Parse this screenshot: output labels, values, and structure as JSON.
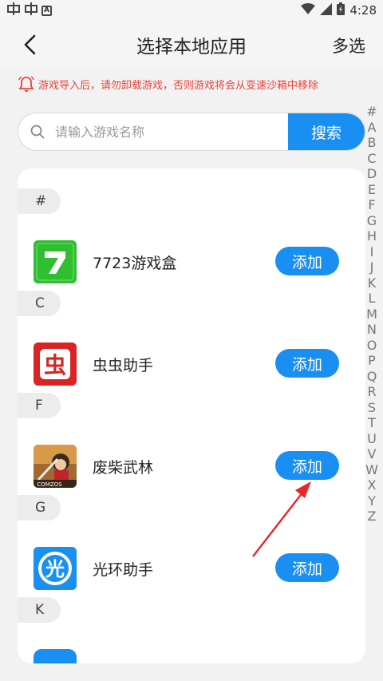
{
  "status_bar": {
    "time": "4:28",
    "left_icon_a": "A"
  },
  "header": {
    "title": "选择本地应用",
    "multi_select_label": "多选"
  },
  "notice": {
    "text": "游戏导入后，请勿卸载游戏，否则游戏将会从变速沙箱中移除"
  },
  "search": {
    "placeholder": "请输入游戏名称",
    "button_label": "搜索"
  },
  "alpha_index": [
    "#",
    "A",
    "B",
    "C",
    "D",
    "E",
    "F",
    "G",
    "H",
    "I",
    "J",
    "K",
    "L",
    "M",
    "N",
    "O",
    "P",
    "Q",
    "R",
    "S",
    "T",
    "U",
    "V",
    "W",
    "X",
    "Y",
    "Z"
  ],
  "sections": [
    {
      "letter": "#",
      "app": {
        "name": "7723游戏盒",
        "add_label": "添加",
        "icon": "7723-app-icon"
      }
    },
    {
      "letter": "C",
      "app": {
        "name": "虫虫助手",
        "add_label": "添加",
        "icon": "chongchong-app-icon"
      }
    },
    {
      "letter": "F",
      "app": {
        "name": "废柴武林",
        "add_label": "添加",
        "icon": "feichai-app-icon"
      }
    },
    {
      "letter": "G",
      "app": {
        "name": "光环助手",
        "add_label": "添加",
        "icon": "guanghuan-app-icon"
      }
    },
    {
      "letter": "K"
    }
  ],
  "icon_text": {
    "chong": "虫",
    "guang": "光",
    "comzos": "COMZOS"
  },
  "colors": {
    "accent": "#1a8ff2",
    "notice_red": "#e8453c",
    "green_icon": "#2fbf2f",
    "red_icon": "#d92424"
  }
}
